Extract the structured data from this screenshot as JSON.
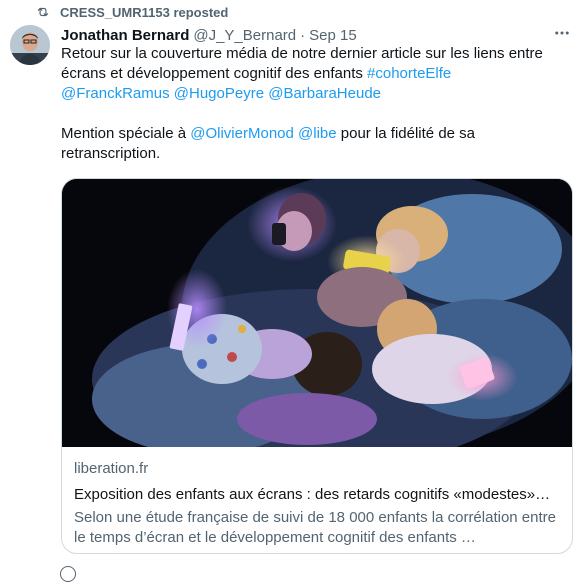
{
  "repost": {
    "label": "CRESS_UMR1153 reposted"
  },
  "tweet": {
    "author_name": "Jonathan Bernard",
    "handle": "@J_Y_Bernard",
    "separator": "·",
    "date": "Sep 15",
    "text1_a": "Retour sur la couverture média de notre dernier article sur les liens entre écrans et développement cognitif des enfants ",
    "hashtag": "#cohorteElfe",
    "mention1": "@FranckRamus",
    "mention2": "@HugoPeyre",
    "mention3": "@BarbaraHeude",
    "text2_a": "Mention spéciale à ",
    "mention4": "@OlivierMonod",
    "mention5": "@libe",
    "text2_b": " pour la fidélité de sa retranscription."
  },
  "card": {
    "domain": "liberation.fr",
    "title": "Exposition des enfants aux écrans : des retards cognitifs «modestes»…",
    "description": "Selon une étude française de suivi de 18 000 enfants la corrélation entre le temps d’écran et le développement cognitif des enfants …"
  },
  "colors": {
    "link": "#1d9bf0",
    "muted": "#536471",
    "text": "#0f1419",
    "border": "#cfd9de"
  },
  "icons": [
    "repost-icon",
    "more-icon",
    "avatar",
    "card-image"
  ]
}
